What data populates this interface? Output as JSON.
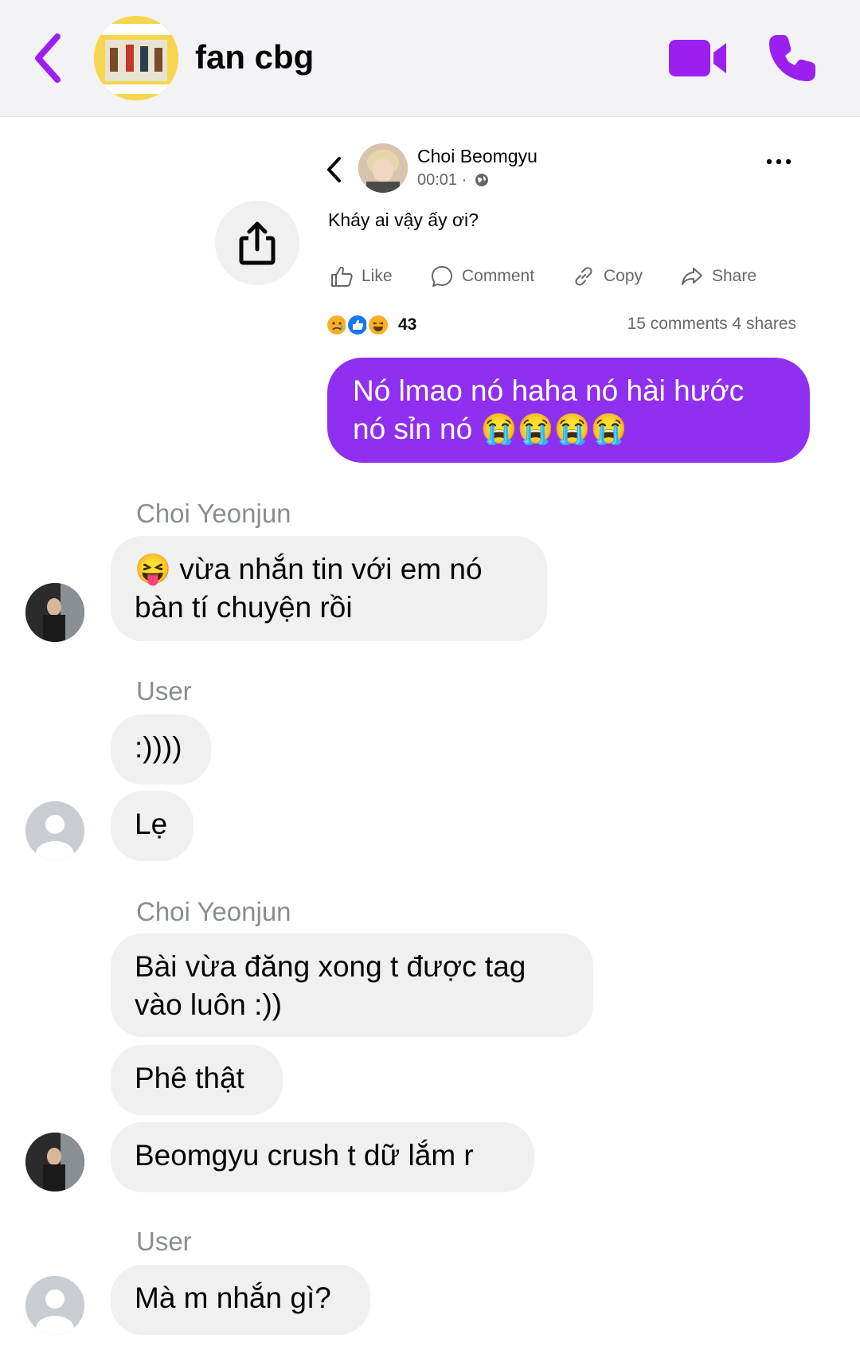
{
  "header": {
    "title": "fan cbg",
    "accent": "#9b20f0"
  },
  "shared_post": {
    "author": "Choi Beomgyu",
    "time": "00:01 ·",
    "text": "Kháy ai vậy ấy ơi?",
    "actions": {
      "like": "Like",
      "comment": "Comment",
      "copy": "Copy",
      "share": "Share"
    },
    "reaction_count": "43",
    "stats": "15 comments 4 shares"
  },
  "outgoing": {
    "text": "Nó lmao nó haha nó hài hước nó sỉn nó",
    "emoji": "😭😭😭😭"
  },
  "messages": {
    "g1_sender": "Choi Yeonjun",
    "g1_m1_emoji": "😝",
    "g1_m1": "vừa nhắn tin với em nó bàn tí chuyện rồi",
    "g2_sender": "User",
    "g2_m1": ":))))",
    "g2_m2": "Lẹ",
    "g3_sender": "Choi Yeonjun",
    "g3_m1": "Bài vừa đăng xong t được tag vào luôn :))",
    "g3_m2": "Phê thật",
    "g3_m3": "Beomgyu crush t dữ lắm r",
    "g4_sender": "User",
    "g4_m1": "Mà m nhắn gì?"
  }
}
